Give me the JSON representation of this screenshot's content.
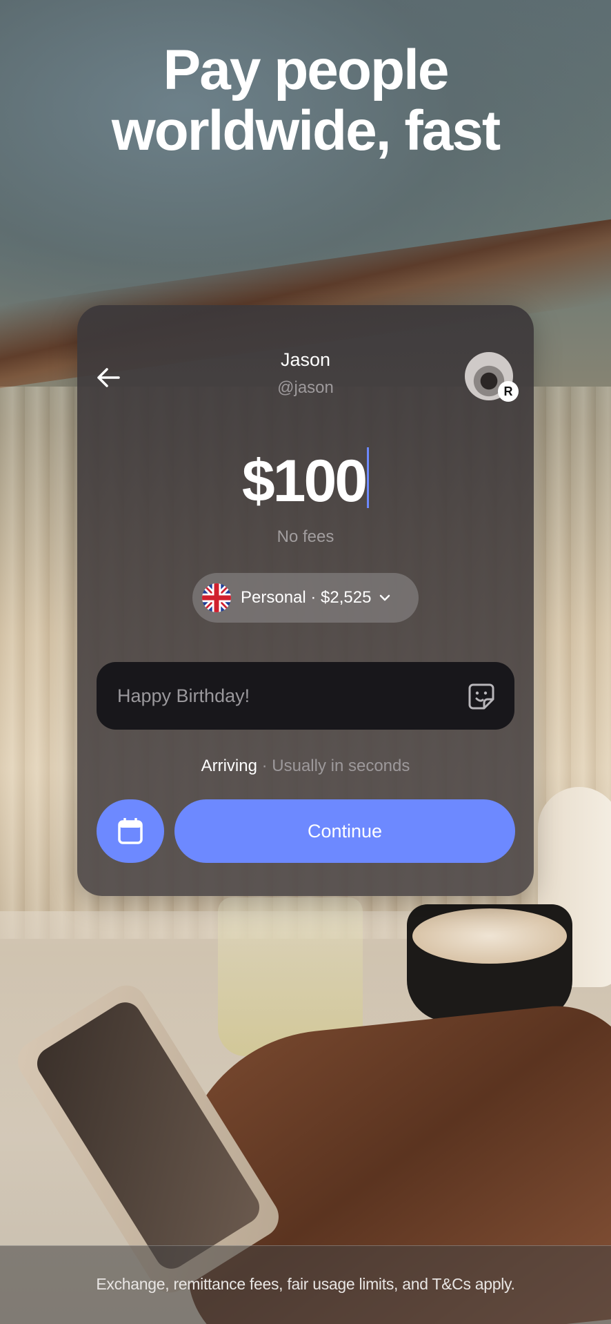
{
  "hero": {
    "headline_line1": "Pay people",
    "headline_line2": "worldwide, fast"
  },
  "card": {
    "recipient": {
      "name": "Jason",
      "handle": "@jason",
      "avatar_badge": "R"
    },
    "amount": "$100",
    "fee_note": "No fees",
    "account": {
      "flag": "uk-flag-icon",
      "label": "Personal · $2,525"
    },
    "message": {
      "value": "",
      "placeholder": "Happy Birthday!"
    },
    "arrival": {
      "label": "Arriving",
      "detail": " · Usually in seconds"
    },
    "continue_label": "Continue",
    "accent_color": "#6d89ff"
  },
  "footer": {
    "disclaimer": "Exchange, remittance fees, fair usage limits, and T&Cs apply."
  }
}
